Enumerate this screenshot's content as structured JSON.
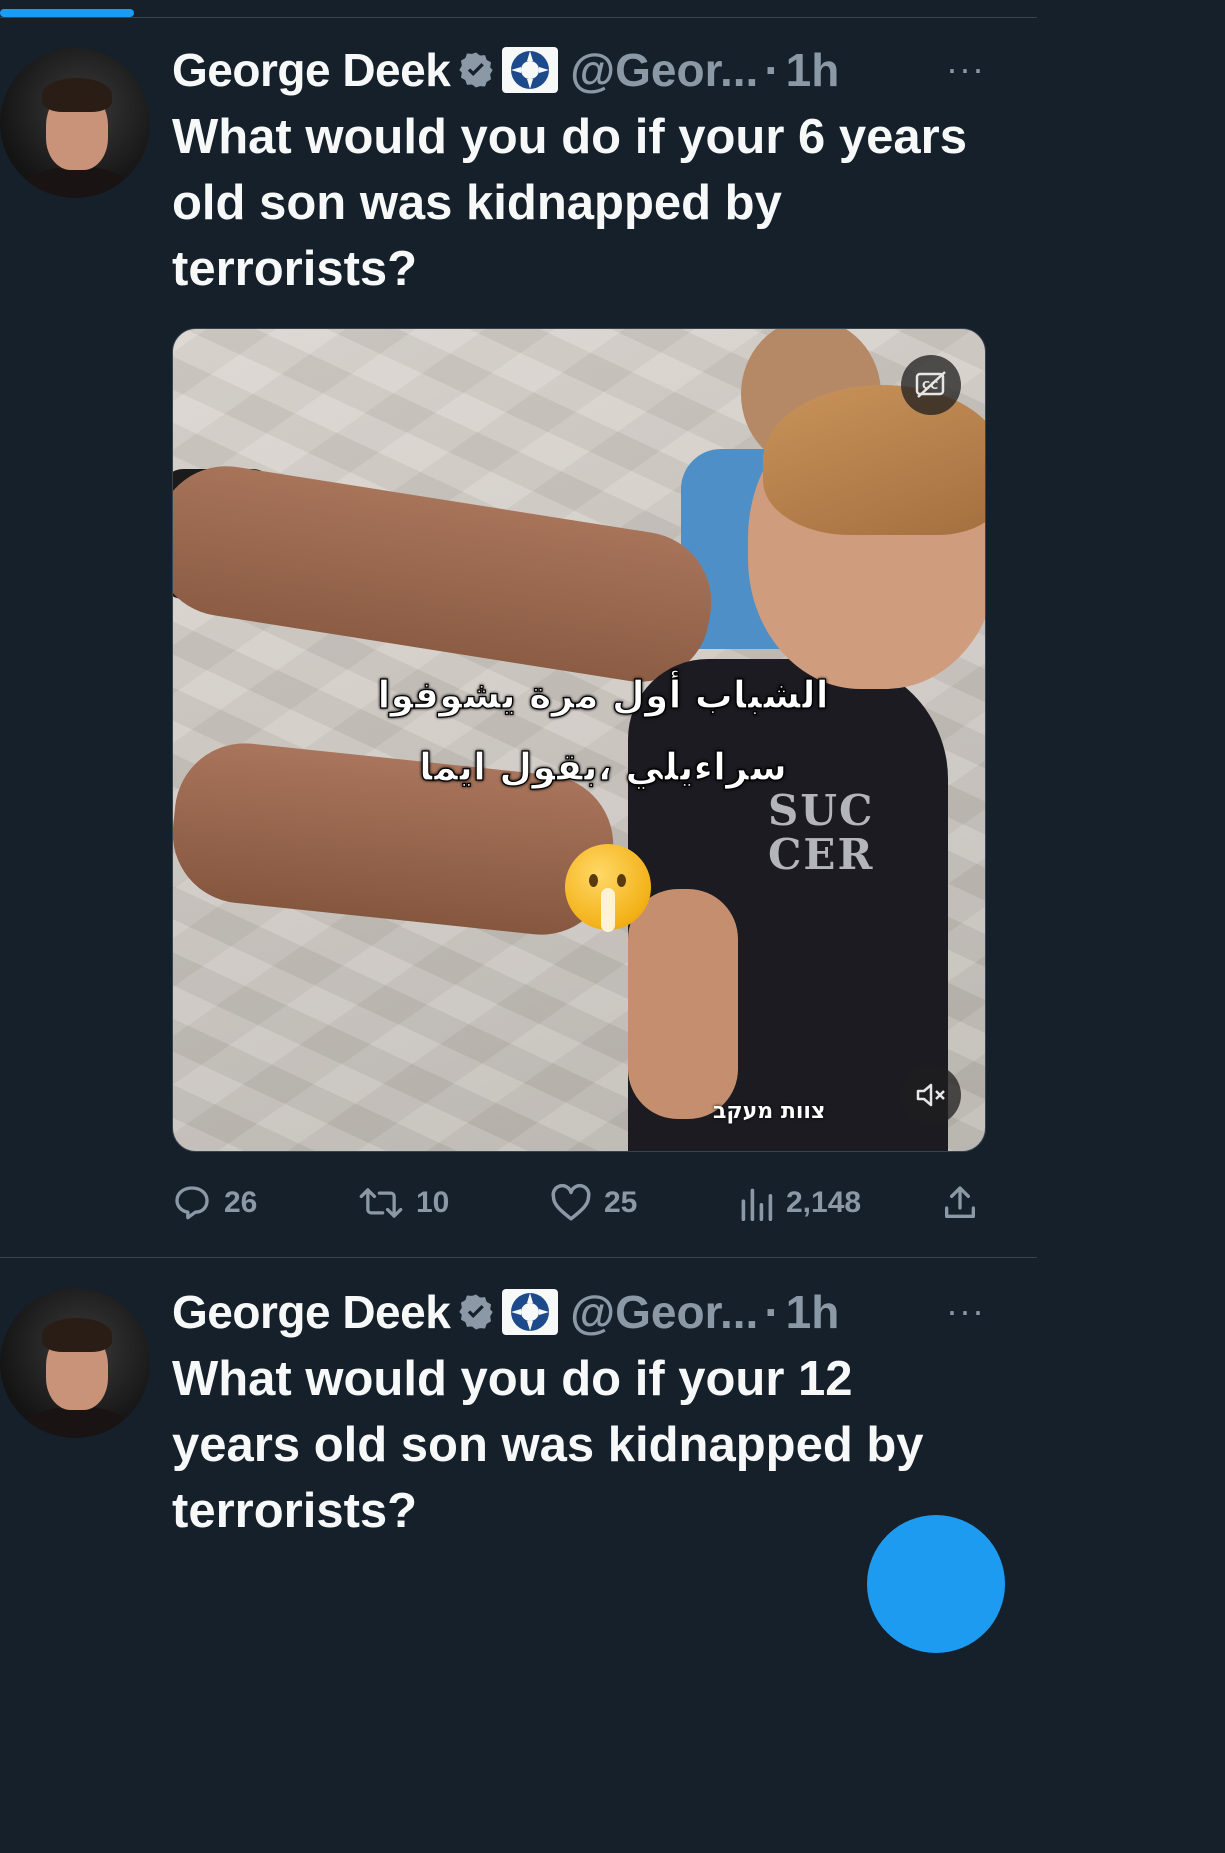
{
  "tweets": [
    {
      "name": "George Deek",
      "handle": "@Geor...",
      "separator": "·",
      "time": "1h",
      "more": "···",
      "text": "What would you do if your 6 years old son was kidnapped by terrorists?",
      "media": {
        "caption_line1": "الشباب أول مرة يشوفوا",
        "caption_line2": "سراءيلي ،بقول ايما",
        "shirt_print": "SUC CER",
        "watermark": "צוות מעקב"
      },
      "stats": {
        "replies": "26",
        "retweets": "10",
        "likes": "25",
        "views": "2,148"
      }
    },
    {
      "name": "George Deek",
      "handle": "@Geor...",
      "separator": "·",
      "time": "1h",
      "more": "···",
      "text": "What would you do if your 12 years old son was kidnapped by terrorists?"
    }
  ],
  "colors": {
    "background": "#15202b",
    "accent": "#1d9bf0",
    "text_primary": "#f7f9f9",
    "text_secondary": "#8b98a5",
    "divider": "#38444d"
  },
  "icons": {
    "verified": "verified-badge-icon",
    "affiliation": "affiliation-badge-icon",
    "reply": "reply-icon",
    "retweet": "retweet-icon",
    "like": "heart-icon",
    "views": "views-icon",
    "share": "share-icon",
    "captions": "captions-icon",
    "mute": "volume-muted-icon"
  }
}
